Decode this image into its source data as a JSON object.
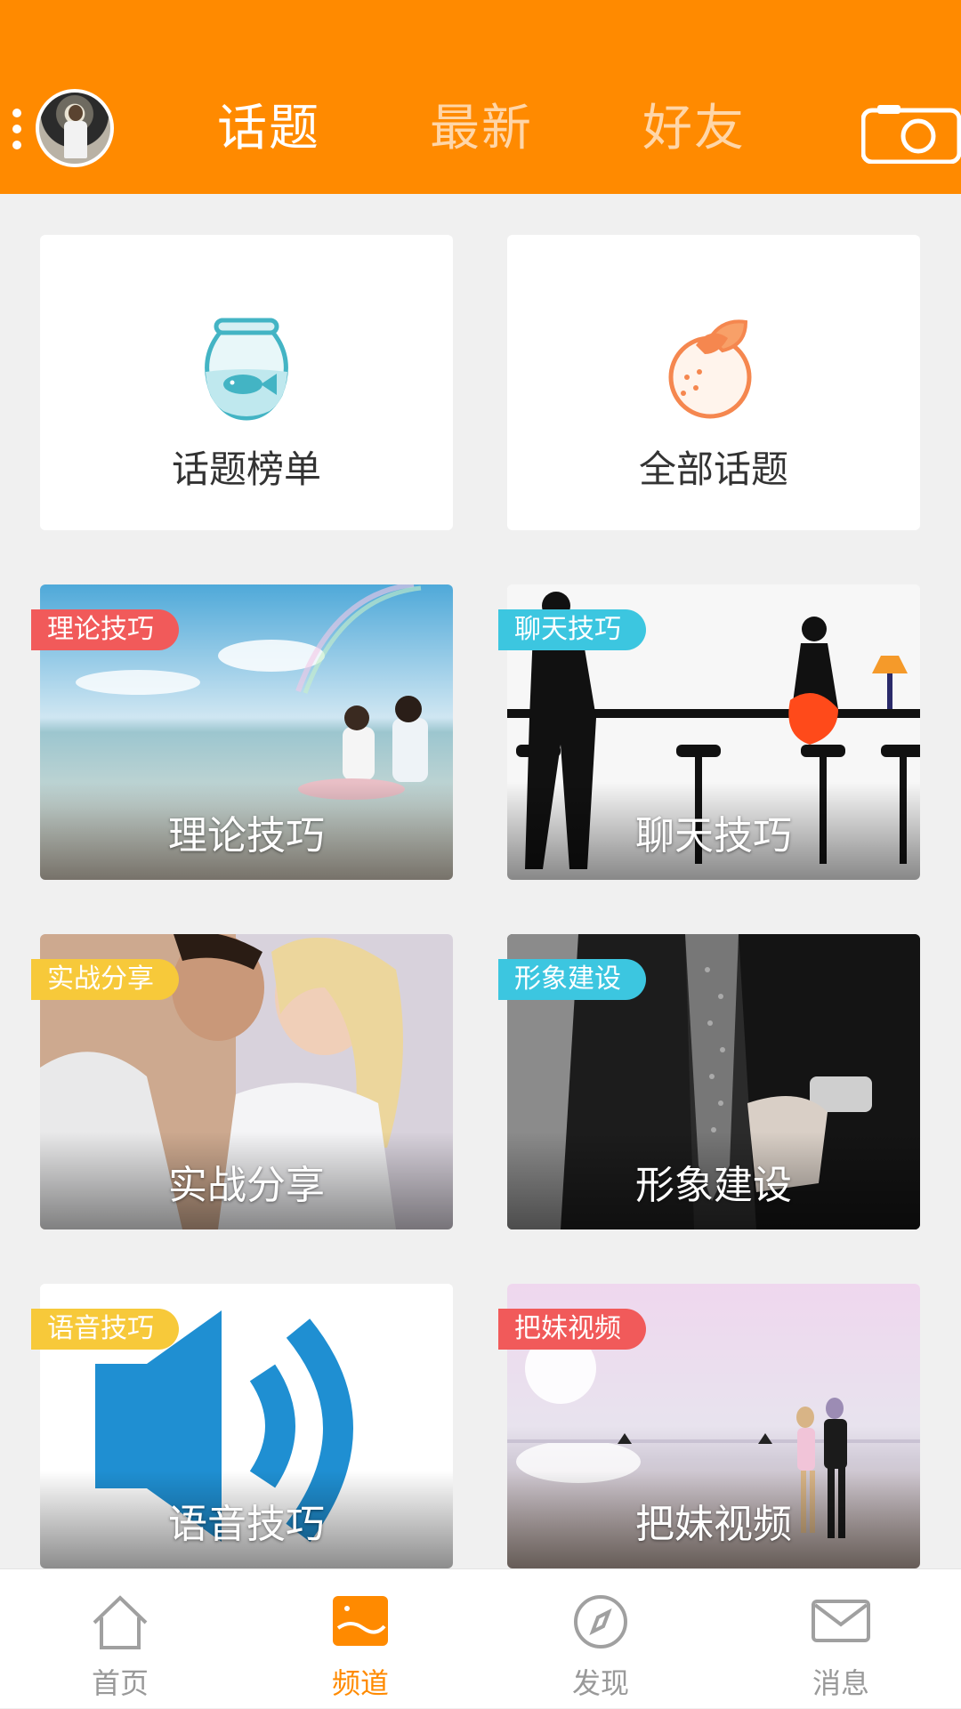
{
  "header": {
    "tabs": [
      {
        "label": "话题",
        "active": true
      },
      {
        "label": "最新",
        "active": false
      },
      {
        "label": "好友",
        "active": false
      }
    ],
    "background_color": "#ff8a00",
    "icons": [
      "menu-dots-icon",
      "avatar",
      "camera-icon"
    ]
  },
  "channels": {
    "top_cards": [
      {
        "label": "话题榜单",
        "icon": "fishbowl-icon"
      },
      {
        "label": "全部话题",
        "icon": "orange-icon"
      }
    ],
    "photo_cards": [
      {
        "tag": "理论技巧",
        "title": "理论技巧",
        "tag_color": "#f15a5a"
      },
      {
        "tag": "聊天技巧",
        "title": "聊天技巧",
        "tag_color": "#3cc6e0"
      },
      {
        "tag": "实战分享",
        "title": "实战分享",
        "tag_color": "#f7c93a"
      },
      {
        "tag": "形象建设",
        "title": "形象建设",
        "tag_color": "#3cc6e0"
      },
      {
        "tag": "语音技巧",
        "title": "语音技巧",
        "tag_color": "#f7c93a"
      },
      {
        "tag": "把妹视频",
        "title": "把妹视频",
        "tag_color": "#f15a5a"
      }
    ]
  },
  "bottom_nav": {
    "items": [
      {
        "label": "首页",
        "icon": "home-icon",
        "active": false
      },
      {
        "label": "频道",
        "icon": "channel-icon",
        "active": true
      },
      {
        "label": "发现",
        "icon": "compass-icon",
        "active": false
      },
      {
        "label": "消息",
        "icon": "mail-icon",
        "active": false
      }
    ],
    "active_color": "#ff8a00"
  }
}
